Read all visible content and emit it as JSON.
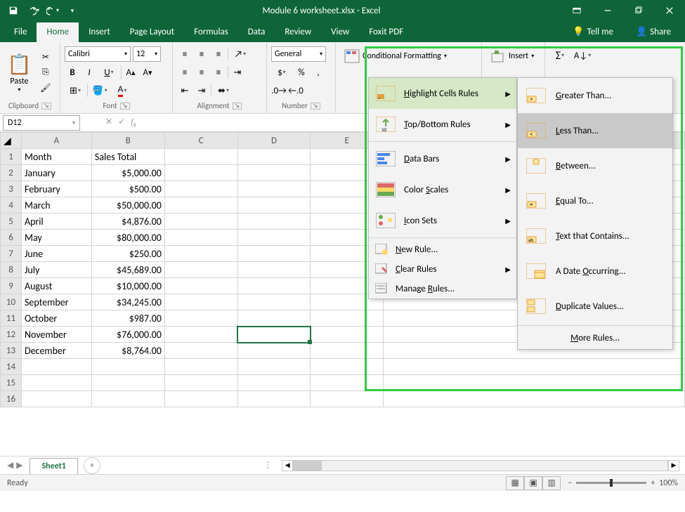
{
  "title": "Module 6 worksheet.xlsx - Excel",
  "qat": {
    "save": "save",
    "undo": "undo",
    "redo": "redo"
  },
  "tabs": [
    "File",
    "Home",
    "Insert",
    "Page Layout",
    "Formulas",
    "Data",
    "Review",
    "View",
    "Foxit PDF"
  ],
  "active_tab": "Home",
  "tellme": "Tell me",
  "share": "Share",
  "ribbon": {
    "clipboard": {
      "paste": "Paste",
      "label": "Clipboard"
    },
    "font": {
      "name": "Calibri",
      "size": "12",
      "label": "Font"
    },
    "alignment": {
      "label": "Alignment"
    },
    "number": {
      "format": "General",
      "label": "Number"
    },
    "styles": {
      "cf": "Conditional Formatting"
    },
    "cells": {
      "insert": "Insert"
    }
  },
  "cf_menu": {
    "items": [
      {
        "label": "Highlight Cells Rules",
        "underline_idx": 0
      },
      {
        "label": "Top/Bottom Rules",
        "underline_idx": 0
      },
      {
        "label": "Data Bars",
        "underline_idx": 0
      },
      {
        "label": "Color Scales",
        "underline_idx": 6
      },
      {
        "label": "Icon Sets",
        "underline_idx": 0
      }
    ],
    "lower": [
      {
        "label": "New Rule...",
        "underline_idx": 0
      },
      {
        "label": "Clear Rules",
        "underline_idx": 0
      },
      {
        "label": "Manage Rules...",
        "underline_idx": 7
      }
    ]
  },
  "cf_submenu": {
    "items": [
      "Greater Than...",
      "Less Than...",
      "Between...",
      "Equal To...",
      "Text that Contains...",
      "A Date Occurring...",
      "Duplicate Values..."
    ],
    "more": "More Rules..."
  },
  "namebox": "D12",
  "columns": [
    "A",
    "B",
    "C",
    "D",
    "E"
  ],
  "rows": [
    1,
    2,
    3,
    4,
    5,
    6,
    7,
    8,
    9,
    10,
    11,
    12,
    13,
    14,
    15,
    16
  ],
  "headers": {
    "A": "Month",
    "B": "Sales Total"
  },
  "table": [
    {
      "month": "January",
      "sales": "$5,000.00"
    },
    {
      "month": "February",
      "sales": "$500.00"
    },
    {
      "month": "March",
      "sales": "$50,000.00"
    },
    {
      "month": "April",
      "sales": "$4,876.00"
    },
    {
      "month": "May",
      "sales": "$80,000.00"
    },
    {
      "month": "June",
      "sales": "$250.00"
    },
    {
      "month": "July",
      "sales": "$45,689.00"
    },
    {
      "month": "August",
      "sales": "$10,000.00"
    },
    {
      "month": "September",
      "sales": "$34,245.00"
    },
    {
      "month": "October",
      "sales": "$987.00"
    },
    {
      "month": "November",
      "sales": "$76,000.00"
    },
    {
      "month": "December",
      "sales": "$8,764.00"
    }
  ],
  "selected_cell": "D12",
  "sheets": {
    "active": "Sheet1"
  },
  "status": {
    "ready": "Ready",
    "zoom": "100%"
  }
}
